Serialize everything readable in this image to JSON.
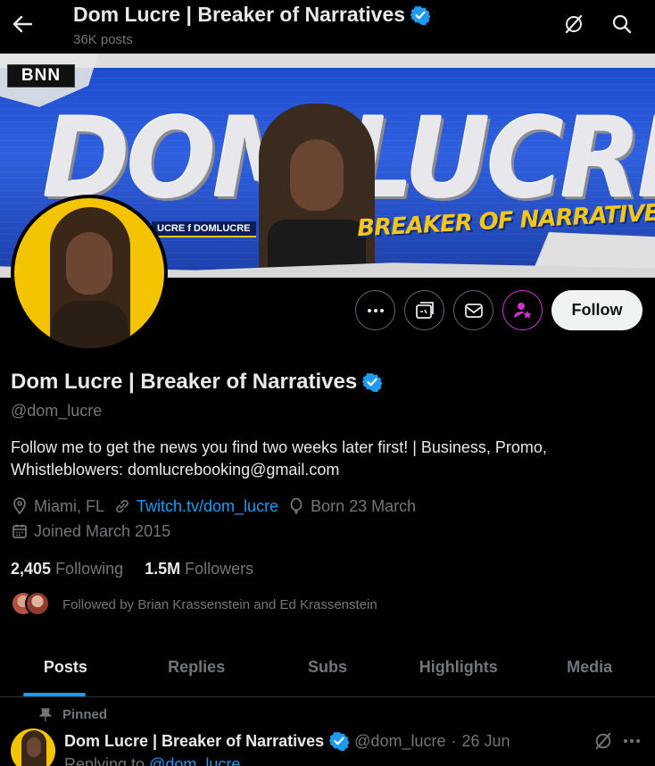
{
  "header": {
    "back_icon": "arrow-left-icon",
    "title": "Dom Lucre | Breaker of Narratives",
    "posts_count": "36K posts",
    "grok_icon": "grok-icon",
    "search_icon": "search-icon"
  },
  "banner": {
    "logo_text": "BNN",
    "big_text": "DOM LUCRE",
    "tagline": "BREAKER OF NARRATIVES",
    "handle_strip": "UCRE  f DOMLUCRE"
  },
  "actions": {
    "more_icon": "more-icon",
    "grok_icon": "grok-analyze-icon",
    "message_icon": "mail-icon",
    "subscribe_icon": "subscribe-star-icon",
    "follow_label": "Follow"
  },
  "profile": {
    "name": "Dom Lucre | Breaker of Narratives",
    "handle": "@dom_lucre",
    "bio": "Follow me to get the news you find two weeks later first! | Business, Promo, Whistleblowers: domlucrebooking@gmail.com",
    "location": "Miami, FL",
    "website": "Twitch.tv/dom_lucre",
    "birthday": "Born 23 March",
    "joined": "Joined March 2015",
    "following_count": "2,405",
    "following_label": "Following",
    "followers_count": "1.5M",
    "followers_label": "Followers",
    "followed_by": "Followed by Brian Krassenstein and Ed Krassenstein"
  },
  "tabs": [
    {
      "label": "Posts",
      "active": true
    },
    {
      "label": "Replies"
    },
    {
      "label": "Subs"
    },
    {
      "label": "Highlights"
    },
    {
      "label": "Media"
    }
  ],
  "pinned_post": {
    "pinned_label": "Pinned",
    "author": "Dom Lucre | Breaker of Narratives",
    "handle": "@dom_lucre",
    "separator": "·",
    "date": "26 Jun",
    "replying_prefix": "Replying to",
    "replying_to": "@dom_lucre"
  },
  "colors": {
    "background": "#000000",
    "accent": "#1d9bf0",
    "verified": "#1d9bf0",
    "subscribe": "#c936cc",
    "muted": "#71767b"
  }
}
